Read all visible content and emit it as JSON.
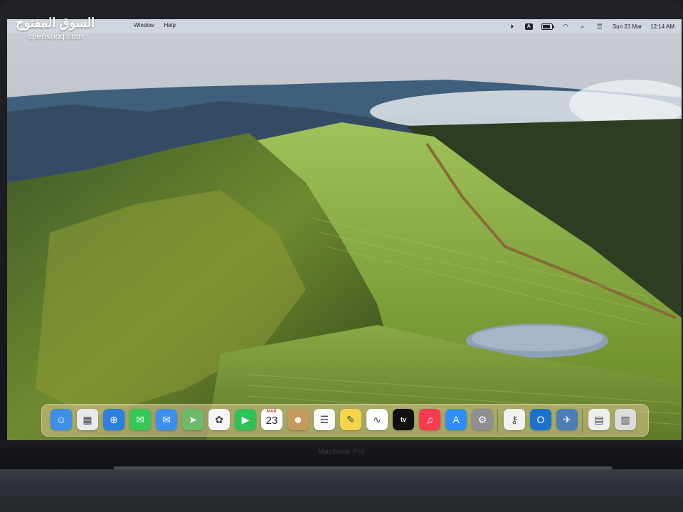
{
  "menubar": {
    "apple": "",
    "items": [
      "Window",
      "Help"
    ],
    "status": {
      "date": "Sun 23 Mar",
      "time": "12:14 AM",
      "icons": [
        "play-circle-icon",
        "input-source-a-icon",
        "battery-icon",
        "wifi-icon",
        "search-icon",
        "control-center-icon"
      ],
      "input_letter": "A",
      "battery_level": 0.85
    }
  },
  "watermark": {
    "arabic": "السوق المفتوح",
    "latin": "opensooq.com"
  },
  "dock": {
    "apps": [
      {
        "name": "Finder",
        "icon": "finder-icon",
        "color": "#3f8ee8"
      },
      {
        "name": "Launchpad",
        "icon": "launchpad-icon",
        "color": "#e9e9ee"
      },
      {
        "name": "Safari",
        "icon": "safari-icon",
        "color": "#2d7fe0"
      },
      {
        "name": "Messages",
        "icon": "messages-icon",
        "color": "#34c759"
      },
      {
        "name": "Mail",
        "icon": "mail-icon",
        "color": "#3b8ff0"
      },
      {
        "name": "Maps",
        "icon": "maps-icon",
        "color": "#6dbb6a"
      },
      {
        "name": "Photos",
        "icon": "photos-icon",
        "color": "#f5f5f5"
      },
      {
        "name": "FaceTime",
        "icon": "facetime-icon",
        "color": "#30c25a"
      },
      {
        "name": "Calendar",
        "icon": "calendar-icon",
        "color": "#ffffff",
        "month": "MAR",
        "day": "23"
      },
      {
        "name": "Contacts",
        "icon": "contacts-icon",
        "color": "#c69a5c"
      },
      {
        "name": "Reminders",
        "icon": "reminders-icon",
        "color": "#fafafa"
      },
      {
        "name": "Notes",
        "icon": "notes-icon",
        "color": "#f6d54a"
      },
      {
        "name": "Freeform",
        "icon": "freeform-icon",
        "color": "#ffffff"
      },
      {
        "name": "TV",
        "icon": "apple-tv-icon",
        "color": "#111111",
        "label": "tv"
      },
      {
        "name": "Music",
        "icon": "music-icon",
        "color": "#fa3a4f"
      },
      {
        "name": "App Store",
        "icon": "app-store-icon",
        "color": "#2f8ef5"
      },
      {
        "name": "System Settings",
        "icon": "settings-gear-icon",
        "color": "#8e8e93"
      },
      {
        "name": "Keychain Access",
        "icon": "keychain-icon",
        "color": "#f2f2f2"
      },
      {
        "name": "Outlook",
        "icon": "outlook-icon",
        "color": "#1a73c8"
      },
      {
        "name": "Flight game",
        "icon": "plane-game-icon",
        "color": "#4c7fb8"
      },
      {
        "name": "Document",
        "icon": "document-icon",
        "color": "#eeeeee"
      },
      {
        "name": "Trash",
        "icon": "trash-icon",
        "color": "#dcdcdc"
      }
    ]
  },
  "device": {
    "model_label": "MacBook Pro"
  }
}
